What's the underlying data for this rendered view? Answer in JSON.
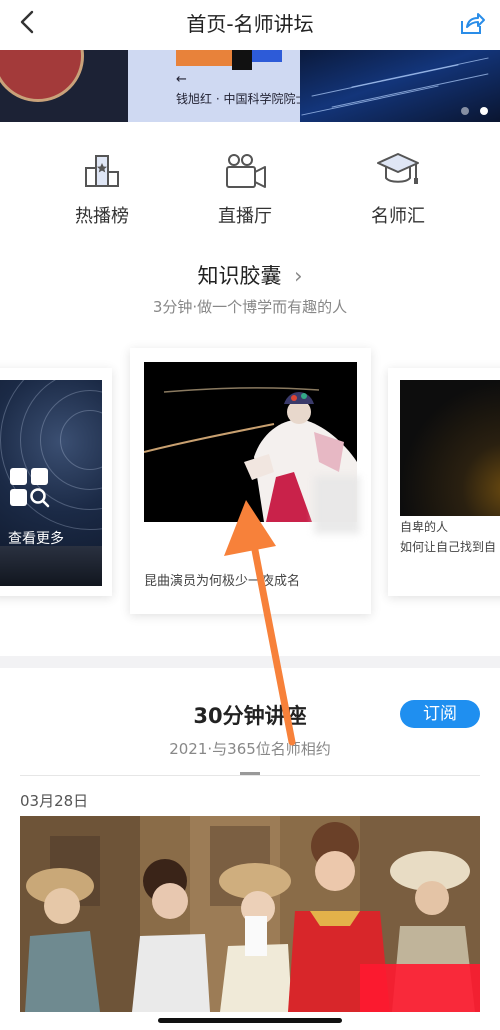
{
  "header": {
    "title": "首页-名师讲坛"
  },
  "banner": {
    "caption": "钱旭红 · 中国科学院院士",
    "arrow": "←",
    "page_count": 2,
    "active_page": 2
  },
  "quick_nav": [
    {
      "label": "热播榜",
      "icon": "ranking-icon"
    },
    {
      "label": "直播厅",
      "icon": "camera-icon"
    },
    {
      "label": "名师汇",
      "icon": "graduation-cap-icon"
    }
  ],
  "capsule": {
    "title": "知识胶囊",
    "subtitle": "3分钟·做一个博学而有趣的人",
    "left_card": {
      "label": "查看更多"
    },
    "main_card": {
      "caption": "昆曲演员为何极少一夜成名"
    },
    "right_card": {
      "line1": "自卑的人",
      "line2": "如何让自己找到自"
    }
  },
  "lecture": {
    "title": "30分钟讲座",
    "subtitle": "2021·与365位名师相约",
    "subscribe": "订阅",
    "date": "03月28日"
  },
  "colors": {
    "accent": "#1f8ff0",
    "annotation_arrow": "#f7813a",
    "red_mark": "#ff1a30"
  }
}
